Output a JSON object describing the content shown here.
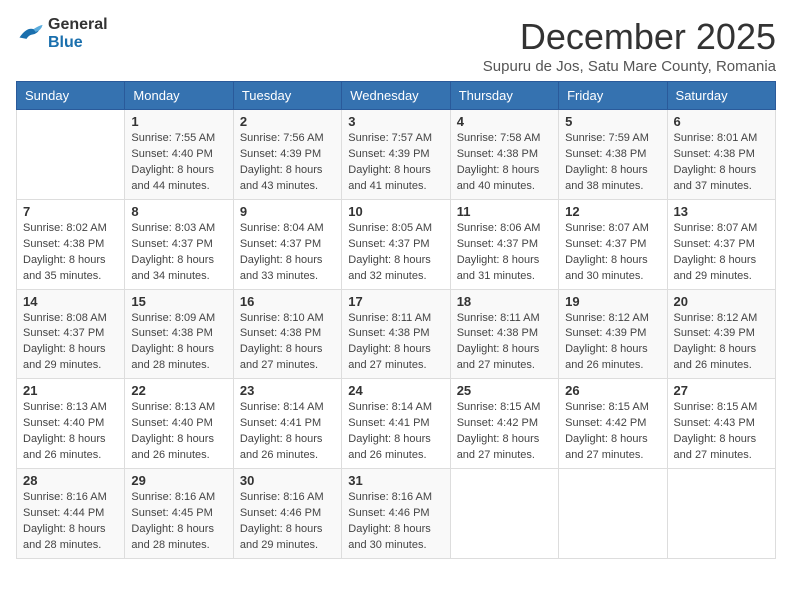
{
  "header": {
    "logo_general": "General",
    "logo_blue": "Blue",
    "month_title": "December 2025",
    "subtitle": "Supuru de Jos, Satu Mare County, Romania"
  },
  "days_of_week": [
    "Sunday",
    "Monday",
    "Tuesday",
    "Wednesday",
    "Thursday",
    "Friday",
    "Saturday"
  ],
  "weeks": [
    [
      {
        "day": "",
        "info": ""
      },
      {
        "day": "1",
        "info": "Sunrise: 7:55 AM\nSunset: 4:40 PM\nDaylight: 8 hours\nand 44 minutes."
      },
      {
        "day": "2",
        "info": "Sunrise: 7:56 AM\nSunset: 4:39 PM\nDaylight: 8 hours\nand 43 minutes."
      },
      {
        "day": "3",
        "info": "Sunrise: 7:57 AM\nSunset: 4:39 PM\nDaylight: 8 hours\nand 41 minutes."
      },
      {
        "day": "4",
        "info": "Sunrise: 7:58 AM\nSunset: 4:38 PM\nDaylight: 8 hours\nand 40 minutes."
      },
      {
        "day": "5",
        "info": "Sunrise: 7:59 AM\nSunset: 4:38 PM\nDaylight: 8 hours\nand 38 minutes."
      },
      {
        "day": "6",
        "info": "Sunrise: 8:01 AM\nSunset: 4:38 PM\nDaylight: 8 hours\nand 37 minutes."
      }
    ],
    [
      {
        "day": "7",
        "info": "Sunrise: 8:02 AM\nSunset: 4:38 PM\nDaylight: 8 hours\nand 35 minutes."
      },
      {
        "day": "8",
        "info": "Sunrise: 8:03 AM\nSunset: 4:37 PM\nDaylight: 8 hours\nand 34 minutes."
      },
      {
        "day": "9",
        "info": "Sunrise: 8:04 AM\nSunset: 4:37 PM\nDaylight: 8 hours\nand 33 minutes."
      },
      {
        "day": "10",
        "info": "Sunrise: 8:05 AM\nSunset: 4:37 PM\nDaylight: 8 hours\nand 32 minutes."
      },
      {
        "day": "11",
        "info": "Sunrise: 8:06 AM\nSunset: 4:37 PM\nDaylight: 8 hours\nand 31 minutes."
      },
      {
        "day": "12",
        "info": "Sunrise: 8:07 AM\nSunset: 4:37 PM\nDaylight: 8 hours\nand 30 minutes."
      },
      {
        "day": "13",
        "info": "Sunrise: 8:07 AM\nSunset: 4:37 PM\nDaylight: 8 hours\nand 29 minutes."
      }
    ],
    [
      {
        "day": "14",
        "info": "Sunrise: 8:08 AM\nSunset: 4:37 PM\nDaylight: 8 hours\nand 29 minutes."
      },
      {
        "day": "15",
        "info": "Sunrise: 8:09 AM\nSunset: 4:38 PM\nDaylight: 8 hours\nand 28 minutes."
      },
      {
        "day": "16",
        "info": "Sunrise: 8:10 AM\nSunset: 4:38 PM\nDaylight: 8 hours\nand 27 minutes."
      },
      {
        "day": "17",
        "info": "Sunrise: 8:11 AM\nSunset: 4:38 PM\nDaylight: 8 hours\nand 27 minutes."
      },
      {
        "day": "18",
        "info": "Sunrise: 8:11 AM\nSunset: 4:38 PM\nDaylight: 8 hours\nand 27 minutes."
      },
      {
        "day": "19",
        "info": "Sunrise: 8:12 AM\nSunset: 4:39 PM\nDaylight: 8 hours\nand 26 minutes."
      },
      {
        "day": "20",
        "info": "Sunrise: 8:12 AM\nSunset: 4:39 PM\nDaylight: 8 hours\nand 26 minutes."
      }
    ],
    [
      {
        "day": "21",
        "info": "Sunrise: 8:13 AM\nSunset: 4:40 PM\nDaylight: 8 hours\nand 26 minutes."
      },
      {
        "day": "22",
        "info": "Sunrise: 8:13 AM\nSunset: 4:40 PM\nDaylight: 8 hours\nand 26 minutes."
      },
      {
        "day": "23",
        "info": "Sunrise: 8:14 AM\nSunset: 4:41 PM\nDaylight: 8 hours\nand 26 minutes."
      },
      {
        "day": "24",
        "info": "Sunrise: 8:14 AM\nSunset: 4:41 PM\nDaylight: 8 hours\nand 26 minutes."
      },
      {
        "day": "25",
        "info": "Sunrise: 8:15 AM\nSunset: 4:42 PM\nDaylight: 8 hours\nand 27 minutes."
      },
      {
        "day": "26",
        "info": "Sunrise: 8:15 AM\nSunset: 4:42 PM\nDaylight: 8 hours\nand 27 minutes."
      },
      {
        "day": "27",
        "info": "Sunrise: 8:15 AM\nSunset: 4:43 PM\nDaylight: 8 hours\nand 27 minutes."
      }
    ],
    [
      {
        "day": "28",
        "info": "Sunrise: 8:16 AM\nSunset: 4:44 PM\nDaylight: 8 hours\nand 28 minutes."
      },
      {
        "day": "29",
        "info": "Sunrise: 8:16 AM\nSunset: 4:45 PM\nDaylight: 8 hours\nand 28 minutes."
      },
      {
        "day": "30",
        "info": "Sunrise: 8:16 AM\nSunset: 4:46 PM\nDaylight: 8 hours\nand 29 minutes."
      },
      {
        "day": "31",
        "info": "Sunrise: 8:16 AM\nSunset: 4:46 PM\nDaylight: 8 hours\nand 30 minutes."
      },
      {
        "day": "",
        "info": ""
      },
      {
        "day": "",
        "info": ""
      },
      {
        "day": "",
        "info": ""
      }
    ]
  ]
}
